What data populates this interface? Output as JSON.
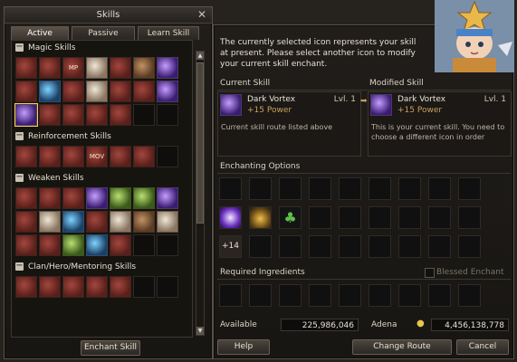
{
  "skills_window": {
    "title": "Skills",
    "tabs": [
      "Active",
      "Passive",
      "Learn Skill"
    ],
    "sections": [
      {
        "title": "Magic Skills"
      },
      {
        "title": "Reinforcement Skills"
      },
      {
        "title": "Weaken Skills"
      },
      {
        "title": "Clan/Hero/Mentoring Skills"
      }
    ],
    "icon_labels": {
      "mp": "MP",
      "mov": "MOV"
    },
    "enchant_button": "Enchant Skill"
  },
  "enchant_window": {
    "message": "The currently selected icon represents your skill at present. Please select another icon to modify your current skill enchant.",
    "current_skill": {
      "label": "Current Skill",
      "name": "Dark Vortex",
      "level": "Lvl. 1",
      "power": "+15 Power",
      "description": "Current skill route listed above"
    },
    "modified_skill": {
      "label": "Modified Skill",
      "name": "Dark Vortex",
      "level": "Lvl. 1",
      "power": "+15 Power",
      "description": "This is your current skill. You need to choose a different icon in order"
    },
    "enchanting_options_label": "Enchanting Options",
    "option_badge": "+14",
    "required_ingredients_label": "Required Ingredients",
    "blessed_enchant_label": "Blessed Enchant",
    "available_label": "Available",
    "available_value": "225,986,046",
    "adena_label": "Adena",
    "adena_value": "4,456,138,778",
    "buttons": {
      "help": "Help",
      "change_route": "Change Route",
      "cancel": "Cancel"
    }
  }
}
